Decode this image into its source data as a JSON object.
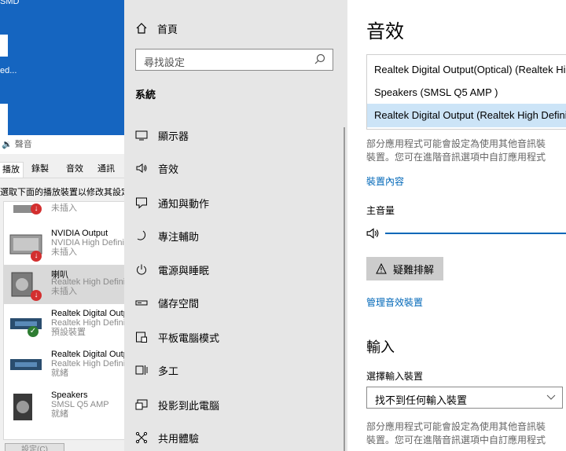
{
  "desktop": {
    "labels": [
      "SMD",
      "ed..."
    ]
  },
  "sound_dialog": {
    "title": "聲音",
    "tabs": [
      "播放",
      "錄製",
      "音效",
      "通訊"
    ],
    "instruction": "選取下面的播放裝置以修改其設定",
    "devices": [
      {
        "name": "",
        "line1": "未插入",
        "line2": "",
        "status": "unplugged"
      },
      {
        "name": "NVIDIA Output",
        "line1": "NVIDIA High Definition Audio",
        "line2": "未插入",
        "status": "unplugged"
      },
      {
        "name": "喇叭",
        "line1": "Realtek High Definition Audio",
        "line2": "未插入",
        "status": "unplugged"
      },
      {
        "name": "Realtek Digital Output",
        "line1": "Realtek High Definition Audio",
        "line2": "預設裝置",
        "status": "default"
      },
      {
        "name": "Realtek Digital Output",
        "line1": "Realtek High Definition Audio",
        "line2": "就緒",
        "status": "ready"
      },
      {
        "name": "Speakers",
        "line1": "SMSL Q5 AMP",
        "line2": "就緒",
        "status": "ready"
      }
    ],
    "button": "設定(C)"
  },
  "sidebar": {
    "home": "首頁",
    "search_placeholder": "尋找設定",
    "section": "系統",
    "items": [
      {
        "label": "顯示器",
        "icon": "monitor-icon"
      },
      {
        "label": "音效",
        "icon": "speaker-icon"
      },
      {
        "label": "通知與動作",
        "icon": "notification-icon"
      },
      {
        "label": "專注輔助",
        "icon": "moon-icon"
      },
      {
        "label": "電源與睡眠",
        "icon": "power-icon"
      },
      {
        "label": "儲存空間",
        "icon": "storage-icon"
      },
      {
        "label": "平板電腦模式",
        "icon": "tablet-icon"
      },
      {
        "label": "多工",
        "icon": "multitask-icon"
      },
      {
        "label": "投影到此電腦",
        "icon": "project-icon"
      },
      {
        "label": "共用體驗",
        "icon": "shared-icon"
      }
    ]
  },
  "content": {
    "title": "音效",
    "output_options": [
      "Realtek Digital Output(Optical) (Realtek High Definition Audio)",
      "Speakers (SMSL Q5 AMP )",
      "Realtek Digital Output (Realtek High Definition Audio)"
    ],
    "selected_output_index": 2,
    "desc1_line1": "部分應用程式可能會設定為使用其他音訊裝",
    "desc1_line2": "裝置。您可在進階音訊選項中自訂應用程式",
    "device_properties_link": "裝置內容",
    "master_volume_label": "主音量",
    "troubleshoot_label": "疑難排解",
    "manage_devices_link": "管理音效裝置",
    "input_title": "輸入",
    "choose_input_label": "選擇輸入裝置",
    "input_select_value": "找不到任何輸入裝置",
    "desc2_line1": "部分應用程式可能會設定為使用其他音訊裝",
    "desc2_line2": "裝置。您可在進階音訊選項中自訂應用程式"
  },
  "colors": {
    "accent": "#0067b8",
    "desktop": "#1565c0",
    "selected_option": "#cce4f7",
    "sidebar_bg": "#e6e6e6"
  }
}
